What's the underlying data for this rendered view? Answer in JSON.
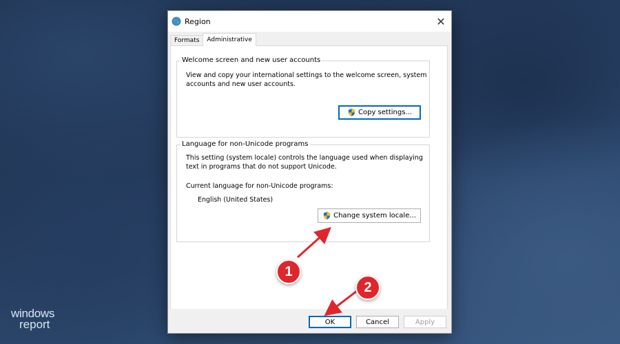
{
  "window": {
    "title": "Region",
    "close_glyph": "✕"
  },
  "tabs": [
    {
      "label": "Formats",
      "active": false
    },
    {
      "label": "Administrative",
      "active": true
    }
  ],
  "welcome_group": {
    "label": "Welcome screen and new user accounts",
    "description_line1": "View and copy your international settings to the welcome screen, system",
    "description_line2": "accounts and new user accounts.",
    "button_label": "Copy settings..."
  },
  "unicode_group": {
    "label": "Language for non-Unicode programs",
    "description_line1": "This setting (system locale) controls the language used when displaying",
    "description_line2": "text in programs that do not support Unicode.",
    "current_label": "Current language for non-Unicode programs:",
    "current_value": "English (United States)",
    "button_label": "Change system locale..."
  },
  "footer": {
    "ok": "OK",
    "cancel": "Cancel",
    "apply": "Apply"
  },
  "annotations": [
    {
      "number": "1"
    },
    {
      "number": "2"
    }
  ],
  "watermark": {
    "line1": "windows",
    "line2": "report"
  },
  "icons": {
    "title": "globe-icon",
    "uac": "shield-icon",
    "close": "close-icon",
    "arrow": "arrow-icon"
  },
  "colors": {
    "accent": "#0067c0",
    "annotation": "#e0262d",
    "arrow": "#e0262d"
  }
}
